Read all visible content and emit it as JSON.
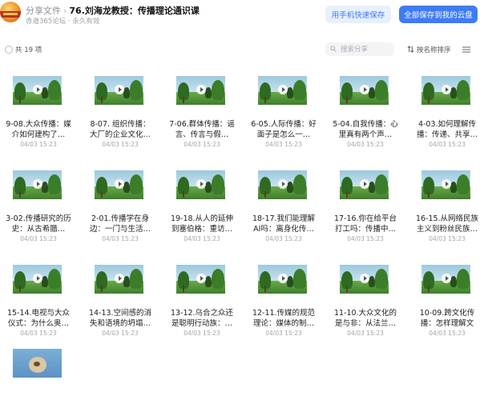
{
  "header": {
    "breadcrumb_link": "分享文件",
    "breadcrumb_sep": "›",
    "title": "76.刘海龙教授：传播理论通识课",
    "meta": "赤道365论坛 · 永久有效",
    "phone_save_label": "用手机快速保存",
    "save_all_label": "全部保存到我的云盘"
  },
  "toolbar": {
    "count_label": "共 19 项",
    "search_placeholder": "搜索分享",
    "sort_label": "按名称排序"
  },
  "files": [
    {
      "name": "9-08.大众传播：媒介如何建构了…",
      "date": "04/03 15:23"
    },
    {
      "name": "8-07. 组织传播：大厂的企业文化…",
      "date": "04/03 15:23"
    },
    {
      "name": "7-06.群体传播：谣言、传言与假…",
      "date": "04/03 15:23"
    },
    {
      "name": "6-05.人际传播：好面子是怎么一…",
      "date": "04/03 15:23"
    },
    {
      "name": "5-04.自我传播：心里真有两个声…",
      "date": "04/03 15:23"
    },
    {
      "name": "4-03.如何理解传播：传递、共享…",
      "date": "04/03 15:23"
    },
    {
      "name": "3-02.传播研究的历史：从古希腊…",
      "date": "04/03 15:23"
    },
    {
      "name": "2-01.传播学在身边：一门与生活…",
      "date": "04/03 15:23"
    },
    {
      "name": "19-18.从人的延伸到塞伯格：重访…",
      "date": "04/03 15:23"
    },
    {
      "name": "18-17.我们能理解AI吗：离身化传…",
      "date": "04/03 15:23"
    },
    {
      "name": "17-16.你在给平台打工吗：传播中…",
      "date": "04/03 15:23"
    },
    {
      "name": "16-15.从网络民族主义到粉丝民族…",
      "date": "04/03 15:23"
    },
    {
      "name": "15-14.电视与大众仪式：为什么奥…",
      "date": "04/03 15:23"
    },
    {
      "name": "14-13.空间感的消失和语境的坍塌…",
      "date": "04/03 15:23"
    },
    {
      "name": "13-12.乌合之众还是聪明行动族：…",
      "date": "04/03 15:23"
    },
    {
      "name": "12-11.传媒的规范理论：媒体的制…",
      "date": "04/03 15:23"
    },
    {
      "name": "11-10.大众文化的是与非：从法兰…",
      "date": "04/03 15:23"
    },
    {
      "name": "10-09.跨文化传播：怎样理解文化…",
      "date": "04/03 15:23"
    }
  ]
}
